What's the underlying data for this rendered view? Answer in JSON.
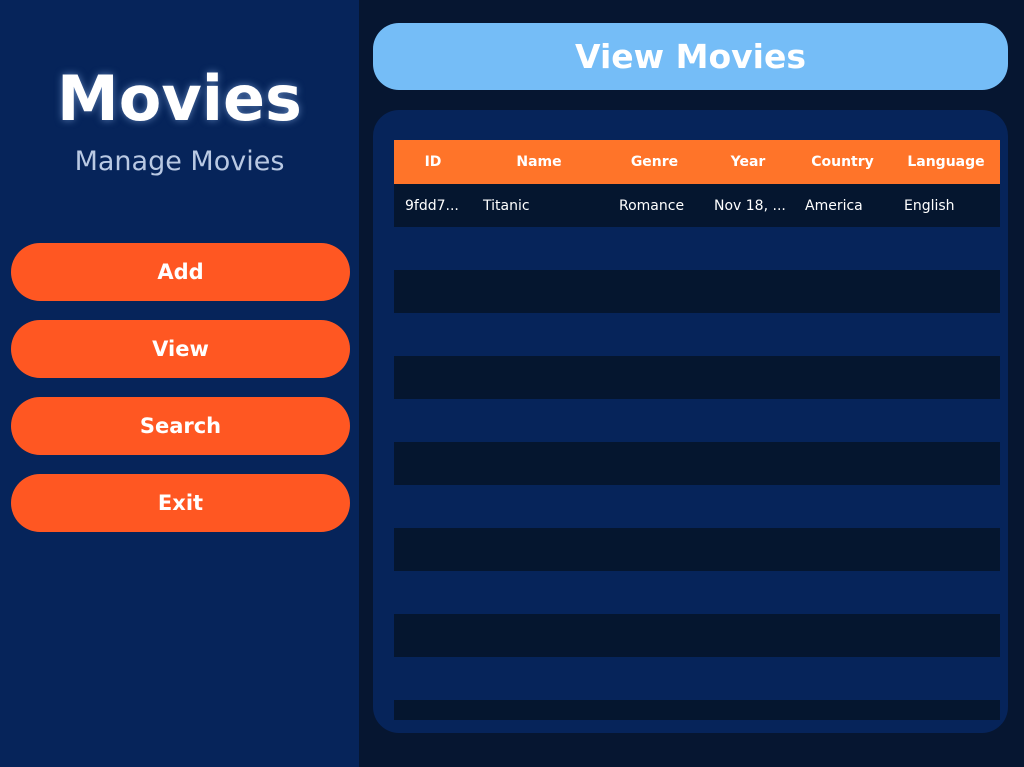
{
  "sidebar": {
    "title": "Movies",
    "subtitle": "Manage Movies",
    "buttons": {
      "add": "Add",
      "view": "View",
      "search": "Search",
      "exit": "Exit"
    }
  },
  "header": {
    "title": "View Movies"
  },
  "table": {
    "columns": {
      "id": "ID",
      "name": "Name",
      "genre": "Genre",
      "year": "Year",
      "country": "Country",
      "language": "Language"
    },
    "rows": [
      {
        "id": "9fdd7...",
        "name": "Titanic",
        "genre": "Romance",
        "year": "Nov 18, ...",
        "country": "America",
        "language": "English"
      }
    ]
  },
  "colors": {
    "sidebar_bg": "#06245a",
    "page_bg": "#061631",
    "accent_button": "#ff5722",
    "header_bar": "#75bdf7",
    "table_header": "#ff7429"
  }
}
